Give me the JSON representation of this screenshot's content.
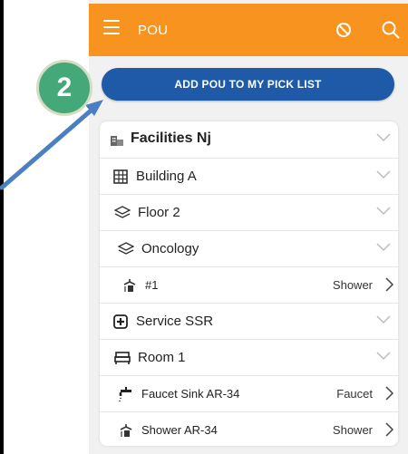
{
  "header": {
    "title": "POU"
  },
  "actions": {
    "add_label": "ADD POU TO MY PICK LIST"
  },
  "callout": {
    "number": "2"
  },
  "tree": [
    {
      "label": "Facilities Nj",
      "icon": "building-icon"
    },
    {
      "label": "Building A",
      "icon": "grid-building-icon"
    },
    {
      "label": "Floor 2",
      "icon": "layers-icon"
    },
    {
      "label": "Oncology",
      "icon": "layers-icon"
    },
    {
      "label": "#1",
      "value": "Shower",
      "icon": "shower-icon"
    },
    {
      "label": "Service SSR",
      "icon": "plus-box-icon"
    },
    {
      "label": "Room 1",
      "icon": "bed-icon"
    },
    {
      "label": "Faucet Sink AR-34",
      "value": "Faucet",
      "icon": "faucet-icon"
    },
    {
      "label": "Shower AR-34",
      "value": "Shower",
      "icon": "shower-icon"
    }
  ],
  "colors": {
    "header": "#f7931e",
    "button": "#1e5aa8",
    "badge": "#45a878",
    "arrow": "#4a7fc0"
  }
}
